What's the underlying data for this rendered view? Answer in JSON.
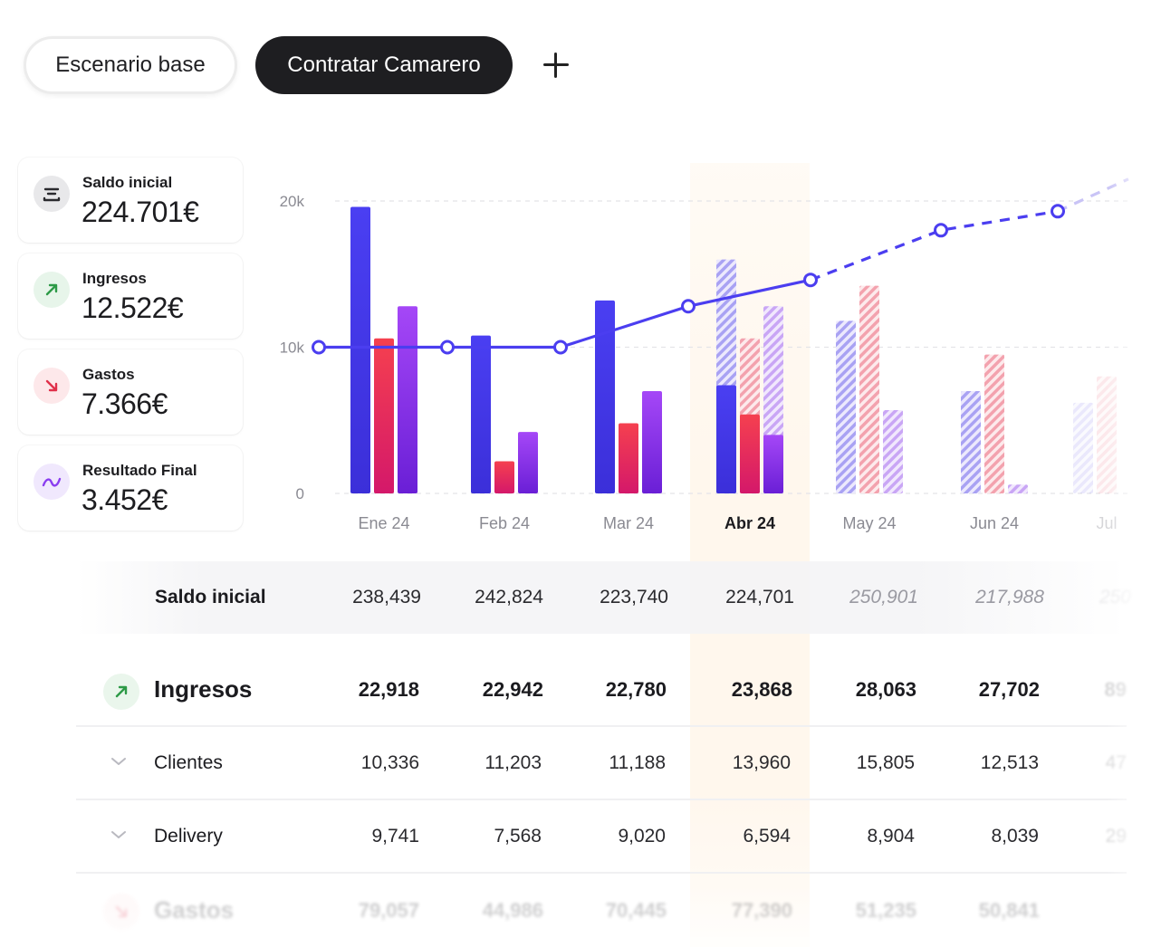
{
  "scenarios": {
    "base_label": "Escenario base",
    "active_label": "Contratar Camarero",
    "add_icon": "plus-icon"
  },
  "kpis": [
    {
      "label": "Saldo inicial",
      "value": "224.701€",
      "icon": "balance-icon",
      "color": "#e8e8ea"
    },
    {
      "label": "Ingresos",
      "value": "12.522€",
      "icon": "arrow-up-right-icon",
      "color": "#e7f5ea"
    },
    {
      "label": "Gastos",
      "value": "7.366€",
      "icon": "arrow-down-right-icon",
      "color": "#fde8ea"
    },
    {
      "label": "Resultado Final",
      "value": "3.452€",
      "icon": "trend-wave-icon",
      "color": "#f0e8fd"
    }
  ],
  "chart_data": {
    "type": "bar",
    "categories": [
      "Ene 24",
      "Feb 24",
      "Mar 24",
      "Abr 24",
      "May 24",
      "Jun 24",
      "Jul"
    ],
    "current_category": "Abr 24",
    "y_ticks": [
      "0",
      "10k",
      "20k"
    ],
    "ylim": [
      0,
      20000
    ],
    "grid": true,
    "series": [
      {
        "values": [
          19600,
          10800,
          13200,
          7400,
          11800,
          7000,
          6200
        ],
        "color": "#4b3ef0"
      },
      {
        "values": [
          10600,
          2200,
          4800,
          5400,
          14200,
          9500,
          8000
        ],
        "color": "#f03a57"
      },
      {
        "values": [
          12800,
          4200,
          7000,
          4000,
          5700,
          600,
          0
        ],
        "color": "#9b3df2"
      }
    ],
    "projected_from_index": 3,
    "projected_stack": [
      {
        "values": [
          16000,
          10600,
          12800
        ],
        "note": "hatched extension of Abr 24"
      }
    ],
    "line": {
      "values": [
        10000,
        10000,
        10000,
        12800,
        14600,
        18000,
        19300,
        21500
      ],
      "color": "#4b3ef0"
    }
  },
  "table": {
    "saldo": {
      "label": "Saldo inicial",
      "values": [
        "238,439",
        "242,824",
        "223,740",
        "224,701",
        "250,901",
        "217,988",
        "250"
      ]
    },
    "ingresos": {
      "label": "Ingresos",
      "icon": "arrow-up-right-icon",
      "values": [
        "22,918",
        "22,942",
        "22,780",
        "23,868",
        "28,063",
        "27,702",
        "89"
      ]
    },
    "clientes": {
      "label": "Clientes",
      "values": [
        "10,336",
        "11,203",
        "11,188",
        "13,960",
        "15,805",
        "12,513",
        "47"
      ]
    },
    "delivery": {
      "label": "Delivery",
      "values": [
        "9,741",
        "7,568",
        "9,020",
        "6,594",
        "8,904",
        "8,039",
        "29"
      ]
    },
    "gastos": {
      "label": "Gastos",
      "icon": "arrow-down-right-icon",
      "values": [
        "79,057",
        "44,986",
        "70,445",
        "77,390",
        "51,235",
        "50,841"
      ]
    }
  }
}
